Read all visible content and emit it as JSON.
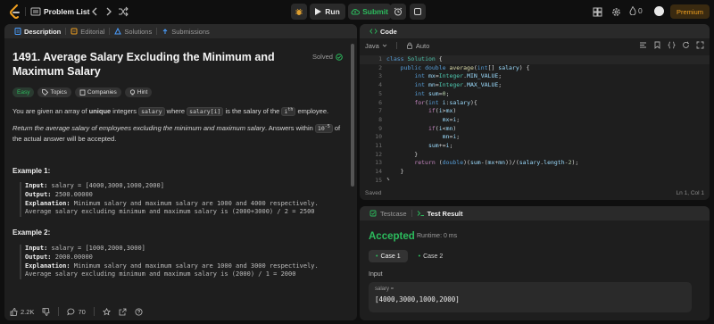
{
  "topbar": {
    "problem_list_label": "Problem List",
    "run_label": "Run",
    "submit_label": "Submit",
    "streak_count": "0",
    "premium_label": "Premium"
  },
  "left_panel": {
    "tabs": [
      {
        "label": "Description",
        "icon": "description-icon"
      },
      {
        "label": "Editorial",
        "icon": "editorial-icon"
      },
      {
        "label": "Solutions",
        "icon": "solutions-icon"
      },
      {
        "label": "Submissions",
        "icon": "submissions-icon"
      }
    ],
    "title": "1491. Average Salary Excluding the Minimum and Maximum Salary",
    "solved_label": "Solved",
    "tags": {
      "difficulty": "Easy",
      "topics": "Topics",
      "companies": "Companies",
      "hint": "Hint"
    },
    "description": {
      "p1_a": "You are given an array of ",
      "p1_b": "unique",
      "p1_c": " integers ",
      "p1_code1": "salary",
      "p1_d": " where ",
      "p1_code2": "salary[i]",
      "p1_e": " is the salary of the ",
      "p1_code3": "i",
      "p1_sup": "th",
      "p1_f": " employee.",
      "p2_a": "Return the average salary of employees excluding the minimum and maximum salary",
      "p2_b": ". Answers within ",
      "p2_code": "10",
      "p2_sup": "-5",
      "p2_c": " of the actual answer will be accepted."
    },
    "examples": [
      {
        "title": "Example 1:",
        "input_label": "Input:",
        "input": " salary = [4000,3000,1000,2000]",
        "output_label": "Output:",
        "output": " 2500.00000",
        "explanation_label": "Explanation:",
        "explanation": " Minimum salary and maximum salary are 1000 and 4000 respectively.",
        "explanation2": "Average salary excluding minimum and maximum salary is (2000+3000) / 2 = 2500"
      },
      {
        "title": "Example 2:",
        "input_label": "Input:",
        "input": " salary = [1000,2000,3000]",
        "output_label": "Output:",
        "output": " 2000.00000",
        "explanation_label": "Explanation:",
        "explanation": " Minimum salary and maximum salary are 1000 and 3000 respectively.",
        "explanation2": "Average salary excluding minimum and maximum salary is (2000) / 1 = 2000"
      }
    ],
    "footer": {
      "likes": "2.2K",
      "comments": "70"
    }
  },
  "code_panel": {
    "tab_label": "Code",
    "language": "Java",
    "auto_label": "Auto",
    "line_numbers": [
      "1",
      "2",
      "3",
      "4",
      "5",
      "6",
      "7",
      "8",
      "9",
      "10",
      "11",
      "12",
      "13",
      "14",
      "15"
    ],
    "status_left": "Saved",
    "status_right": "Ln 1, Col 1"
  },
  "result_panel": {
    "tabs": [
      {
        "label": "Testcase"
      },
      {
        "label": "Test Result"
      }
    ],
    "verdict": "Accepted",
    "runtime": "Runtime: 0 ms",
    "cases": [
      "Case 1",
      "Case 2"
    ],
    "input_label": "Input",
    "input_var": "salary =",
    "input_value": "[4000,3000,1000,2000]"
  },
  "colors": {
    "accent_green": "#2cbb5d",
    "accent_orange": "#f0a020",
    "panel_bg": "#1e1e1e",
    "page_bg": "#0f0f0f"
  }
}
